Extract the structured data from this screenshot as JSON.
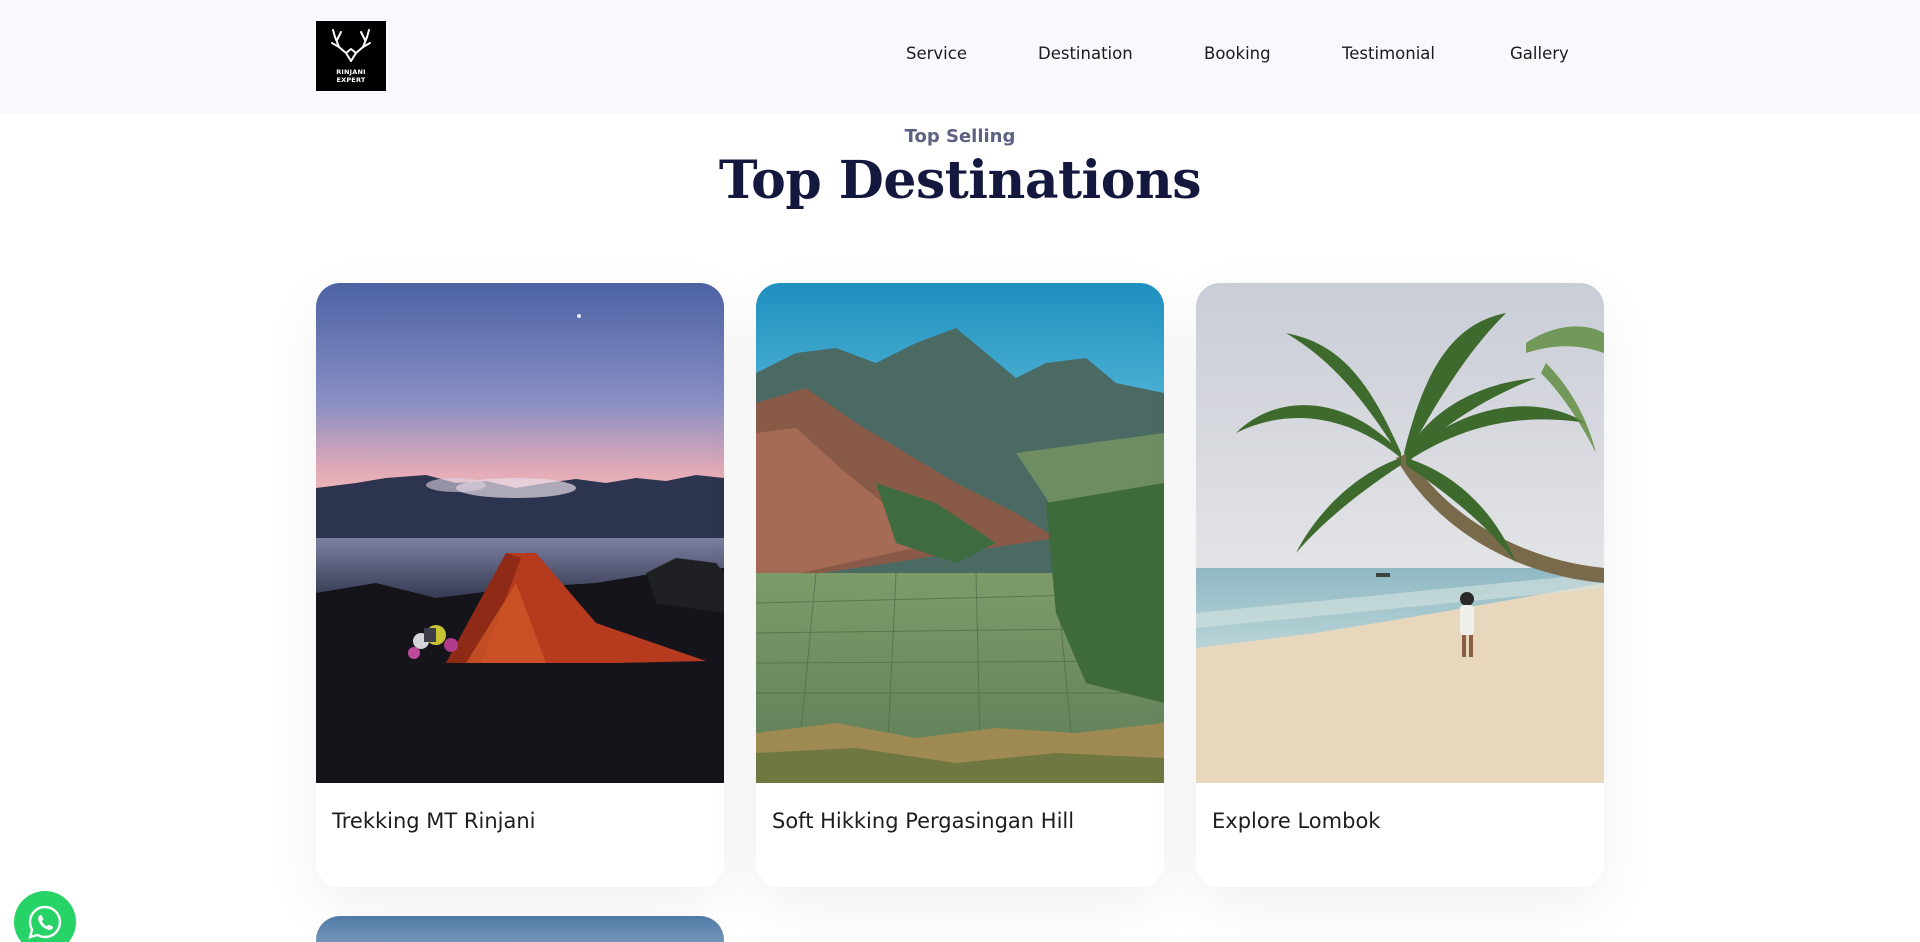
{
  "brand": {
    "logo_line1": "RINJANI",
    "logo_line2": "EXPERT"
  },
  "nav": [
    "Service",
    "Destination",
    "Booking",
    "Testimonial",
    "Gallery"
  ],
  "section": {
    "eyebrow": "Top Selling",
    "title": "Top Destinations"
  },
  "cards": [
    {
      "name": "Trekking MT Rinjani",
      "image": "lake-camping-tent-photo"
    },
    {
      "name": "Soft Hikking Pergasingan Hill",
      "image": "mountain-valley-rice-fields-photo"
    },
    {
      "name": "Explore Lombok",
      "image": "beach-palm-tree-photo"
    }
  ],
  "whatsapp": {
    "icon": "whatsapp-icon",
    "color": "#25d366"
  }
}
